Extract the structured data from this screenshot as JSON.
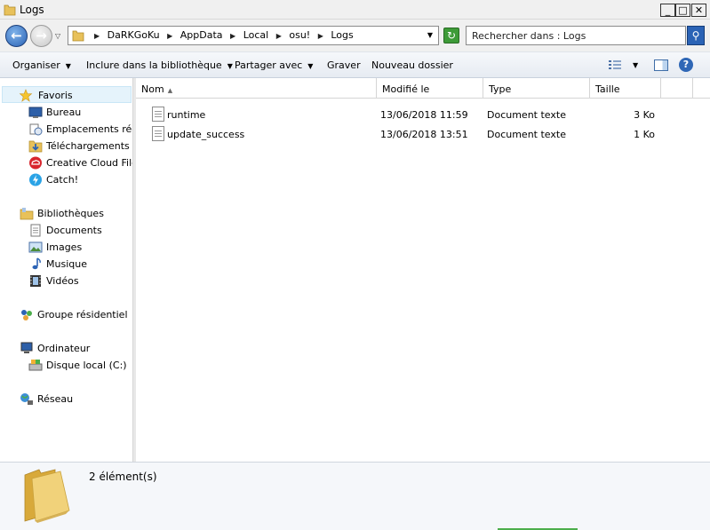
{
  "window": {
    "title": "Logs",
    "controls": {
      "minimize": "_",
      "maximize": "□",
      "close": "✕"
    }
  },
  "address": {
    "crumbs": [
      "DaRKGoKu",
      "AppData",
      "Local",
      "osu!",
      "Logs"
    ],
    "search_placeholder": "Rechercher dans : Logs"
  },
  "toolbar": {
    "organize": "Organiser",
    "include": "Inclure dans la bibliothèque",
    "share": "Partager avec",
    "burn": "Graver",
    "new_folder": "Nouveau dossier"
  },
  "nav": {
    "favorites": "Favoris",
    "desktop": "Bureau",
    "recent": "Emplacements récents",
    "downloads": "Téléchargements",
    "ccfiles": "Creative Cloud Files",
    "catch": "Catch!",
    "libraries": "Bibliothèques",
    "documents": "Documents",
    "images": "Images",
    "music": "Musique",
    "videos": "Vidéos",
    "homegroup": "Groupe résidentiel",
    "computer": "Ordinateur",
    "localdisk": "Disque local (C:)",
    "network": "Réseau"
  },
  "columns": {
    "name": "Nom",
    "modified": "Modifié le",
    "type": "Type",
    "size": "Taille"
  },
  "files": [
    {
      "name": "runtime",
      "modified": "13/06/2018 11:59",
      "type": "Document texte",
      "size": "3 Ko"
    },
    {
      "name": "update_success",
      "modified": "13/06/2018 13:51",
      "type": "Document texte",
      "size": "1 Ko"
    }
  ],
  "details": {
    "count": "2 élément(s)"
  },
  "icons": {
    "back": "back-arrow-icon",
    "forward": "forward-arrow-icon",
    "refresh": "refresh-icon",
    "search": "search-icon",
    "help": "help-icon",
    "folder": "folder-icon",
    "file": "text-file-icon"
  },
  "colors": {
    "accent": "#2b63b5",
    "folder": "#e8c15a",
    "selection": "#e5f3fb"
  }
}
